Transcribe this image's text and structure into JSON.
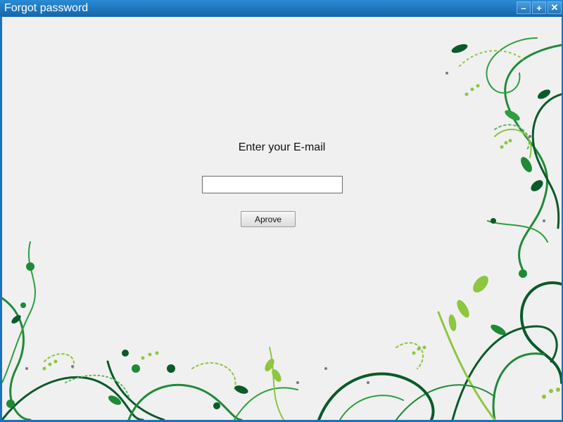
{
  "window": {
    "title": "Forgot password",
    "buttons": {
      "minimize_icon": "minimize-icon",
      "maximize_icon": "maximize-icon",
      "close_icon": "close-icon"
    }
  },
  "form": {
    "prompt": "Enter your E-mail",
    "email_value": "",
    "submit_label": "Aprove"
  },
  "colors": {
    "titlebar": "#1a73b8",
    "background": "#f0f0f0",
    "decor_dark_green": "#0a5a2a",
    "decor_green": "#2e9e3e",
    "decor_light_green": "#8dc63f"
  }
}
